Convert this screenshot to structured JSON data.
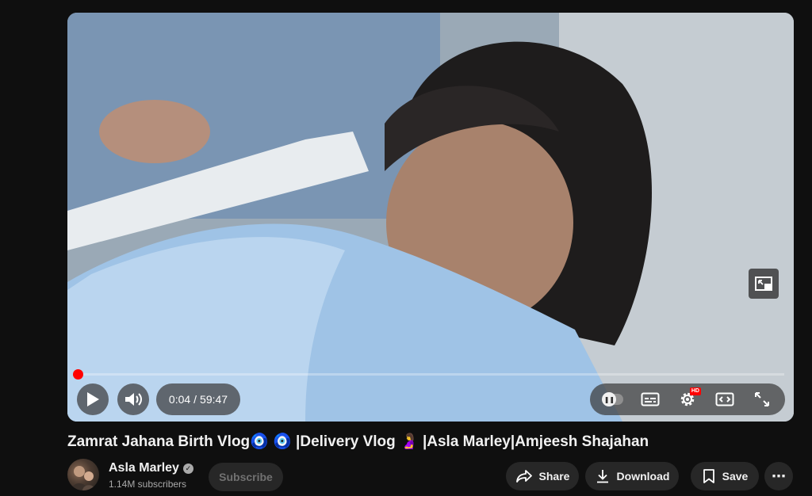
{
  "video": {
    "current_time": "0:04",
    "separator": "/",
    "duration": "59:47",
    "progress_fraction": 0.0011
  },
  "player_icons": {
    "play": "play-icon",
    "volume": "volume-icon",
    "autoplay": "autoplay-toggle",
    "subtitles": "subtitles-icon",
    "settings": "settings-gear-icon",
    "theater": "theater-mode-icon",
    "fullscreen": "fullscreen-icon",
    "miniplayer": "miniplayer-icon",
    "hd_badge": "HD"
  },
  "title": "Zamrat Jahana Birth Vlog🧿 🧿 |Delivery Vlog  🤰 |Asla Marley|Amjeesh Shajahan",
  "channel": {
    "name": "Asla Marley",
    "subscribers": "1.14M subscribers"
  },
  "buttons": {
    "subscribe": "Subscribe",
    "share": "Share",
    "download": "Download",
    "save": "Save",
    "more": "⋯"
  },
  "colors": {
    "background": "#0f0f0f",
    "progress": "#ff0000",
    "button_bg": "#272727"
  }
}
